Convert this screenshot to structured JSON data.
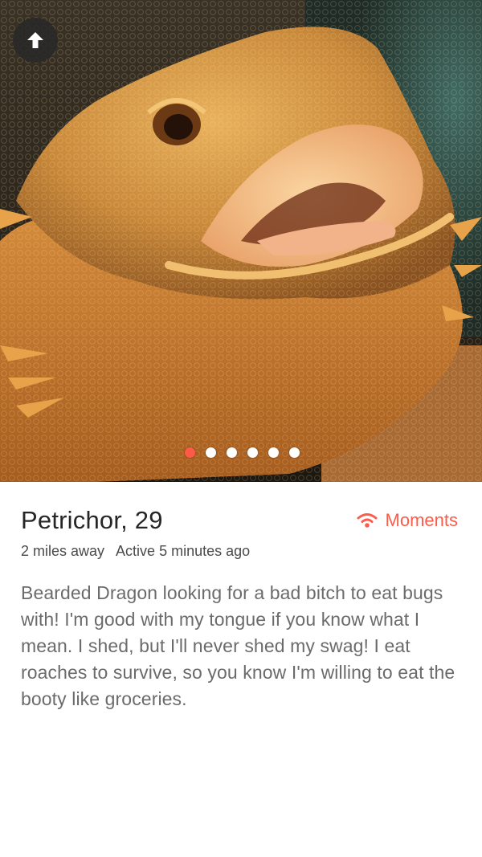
{
  "photo": {
    "subject": "bearded-dragon-photo",
    "dots_total": 6,
    "dots_active_index": 0
  },
  "profile": {
    "name": "Petrichor",
    "age": "29",
    "distance": "2 miles away",
    "activity": "Active 5 minutes ago",
    "bio": "Bearded Dragon looking for a bad bitch to eat bugs with! I'm good with my tongue if you know what I mean. I shed, but I'll never shed my swag! I eat roaches to survive, so you know I'm willing to eat the booty like groceries."
  },
  "moments": {
    "label": "Moments",
    "icon": "wifi-signal-icon",
    "color": "#fd5c4a"
  },
  "controls": {
    "back_icon": "arrow-up-icon"
  },
  "colors": {
    "accent": "#ff5a47",
    "text_primary": "#262626",
    "text_secondary": "#6b6b6b"
  }
}
